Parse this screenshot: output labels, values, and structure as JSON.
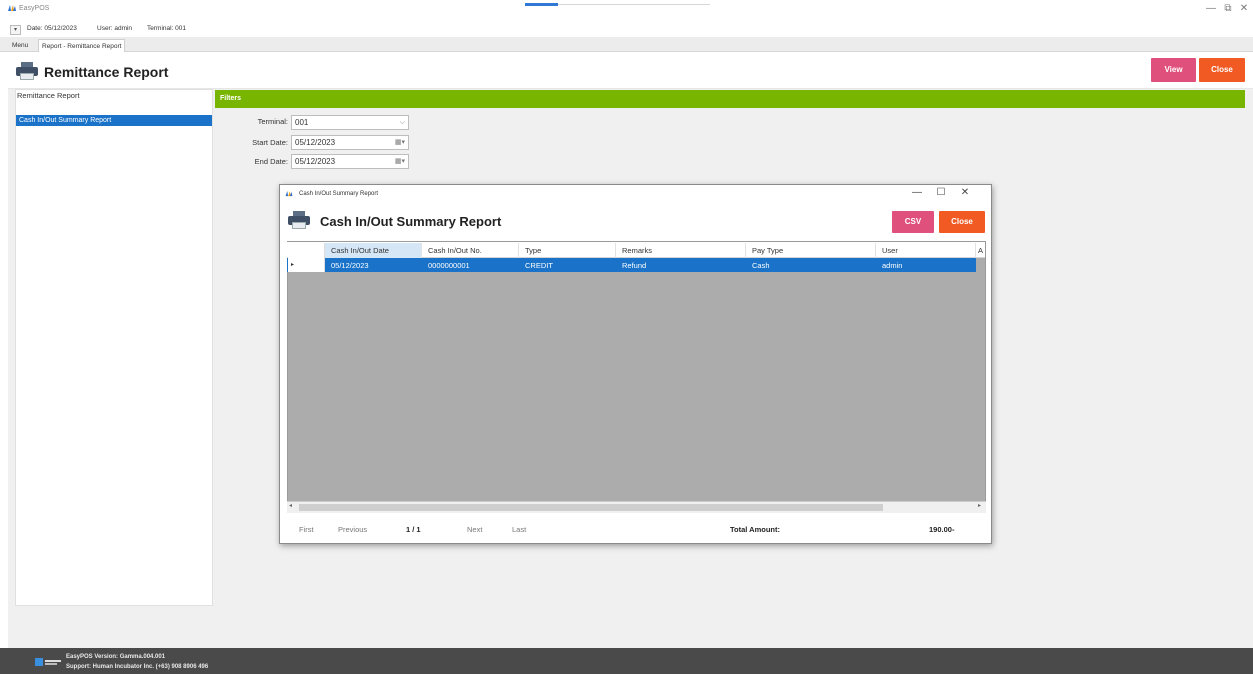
{
  "window": {
    "title": "EasyPOS",
    "progress": 0.18,
    "controls": {
      "minimize": "—",
      "restore": "⧉",
      "close": "✕"
    }
  },
  "info": {
    "dropdown_glyph": "▾",
    "date": "Date: 05/12/2023",
    "user": "User: admin",
    "terminal": "Terminal: 001"
  },
  "tabs": [
    {
      "label": "Menu"
    },
    {
      "label": "Report - Remittance Report"
    }
  ],
  "header": {
    "title": "Remittance Report",
    "view_label": "View",
    "close_label": "Close"
  },
  "sidebar": {
    "heading": "Remittance Report",
    "items": [
      {
        "label": "Cash In/Out Summary Report"
      }
    ]
  },
  "filters": {
    "title": "Filters",
    "terminal_label": "Terminal:",
    "terminal_value": "001",
    "start_label": "Start Date:",
    "start_value": "05/12/2023",
    "end_label": "End Date:",
    "end_value": "05/12/2023",
    "calendar_glyph": "▦▾",
    "select_glyph": "⌵"
  },
  "dialog": {
    "window_title": "Cash In/Out Summary Report",
    "controls": {
      "minimize": "—",
      "maximize": "☐",
      "close": "✕"
    },
    "heading": "Cash In/Out Summary Report",
    "csv_label": "CSV",
    "close_label": "Close",
    "columns": [
      "Cash In/Out Date",
      "Cash In/Out No.",
      "Type",
      "Remarks",
      "Pay Type",
      "User",
      "A"
    ],
    "rows": [
      {
        "marker": "▸",
        "date": "05/12/2023",
        "number": "0000000001",
        "type": "CREDIT",
        "remarks": "Refund",
        "pay_type": "Cash",
        "user": "admin"
      }
    ],
    "pager": {
      "first": "First",
      "previous": "Previous",
      "page": "1 / 1",
      "next": "Next",
      "last": "Last"
    },
    "total_label": "Total Amount:",
    "total_value": "190.00-",
    "scroll_left": "◂",
    "scroll_right": "▸"
  },
  "status": {
    "version": "EasyPOS Version: Gamma.004.001",
    "support": "Support: Human Incubator Inc. (+63) 908 8906 496"
  },
  "colors": {
    "accent_blue": "#1a73c8",
    "filters_green": "#78b500",
    "pink_button": "#e0507c",
    "orange_button": "#f15a22",
    "status_bar": "#4a4a4a"
  }
}
